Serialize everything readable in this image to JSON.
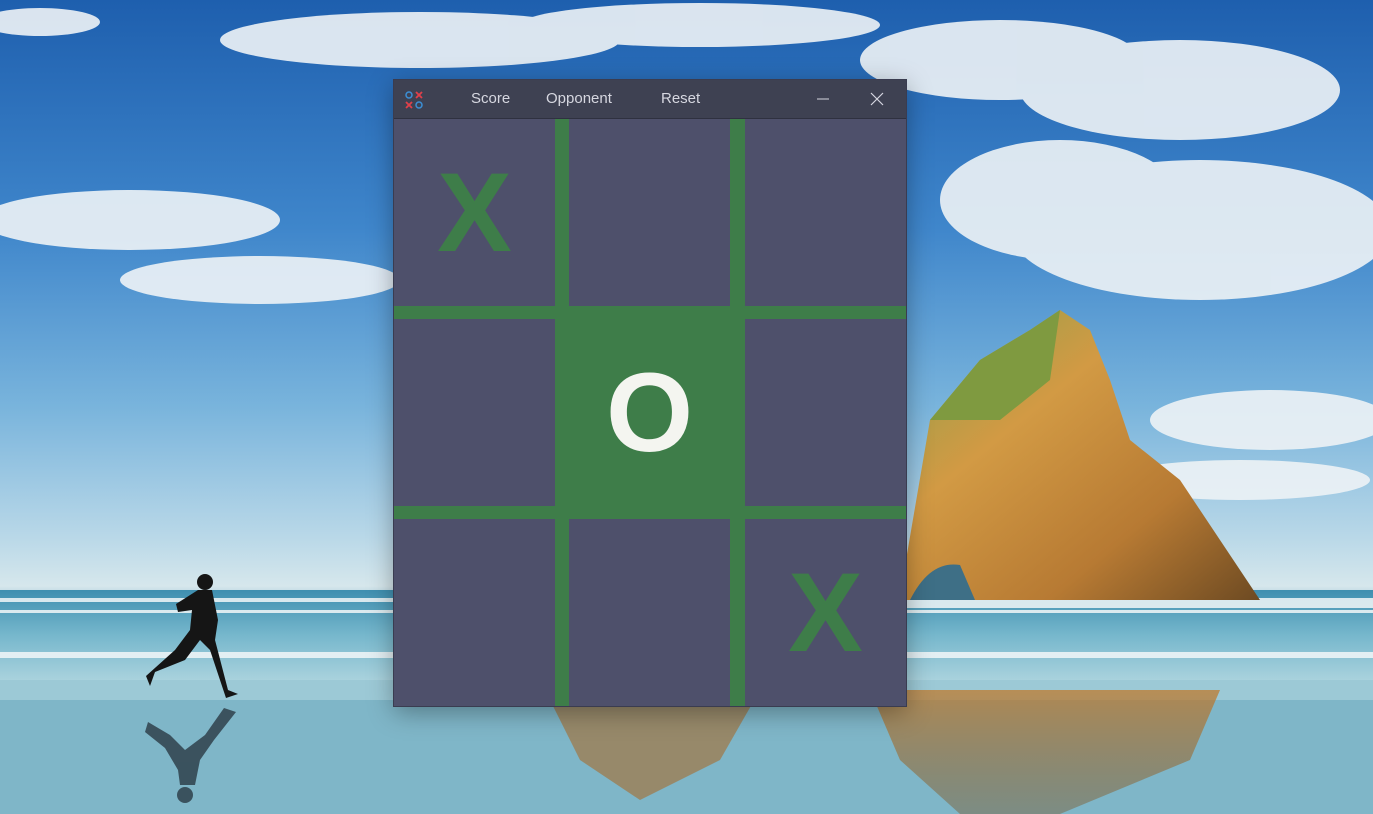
{
  "window": {
    "menu": {
      "score": "Score",
      "opponent": "Opponent",
      "reset": "Reset"
    },
    "controls": [
      "minimize",
      "close"
    ]
  },
  "board": {
    "cells": [
      {
        "mark": "X",
        "highlight": false
      },
      {
        "mark": "",
        "highlight": false
      },
      {
        "mark": "",
        "highlight": false
      },
      {
        "mark": "",
        "highlight": false
      },
      {
        "mark": "O",
        "highlight": true
      },
      {
        "mark": "",
        "highlight": false
      },
      {
        "mark": "",
        "highlight": false
      },
      {
        "mark": "",
        "highlight": false
      },
      {
        "mark": "X",
        "highlight": false
      }
    ]
  },
  "colors": {
    "titlebar": "#3e4152",
    "cell": "#4e506b",
    "grid_green": "#3e7d49",
    "x_mark": "#3e7d49",
    "o_mark": "#f4f5f0",
    "menu_text": "#d6d7e0"
  },
  "icons": [
    "app-tictactoe-icon",
    "minimize-icon",
    "close-icon"
  ]
}
